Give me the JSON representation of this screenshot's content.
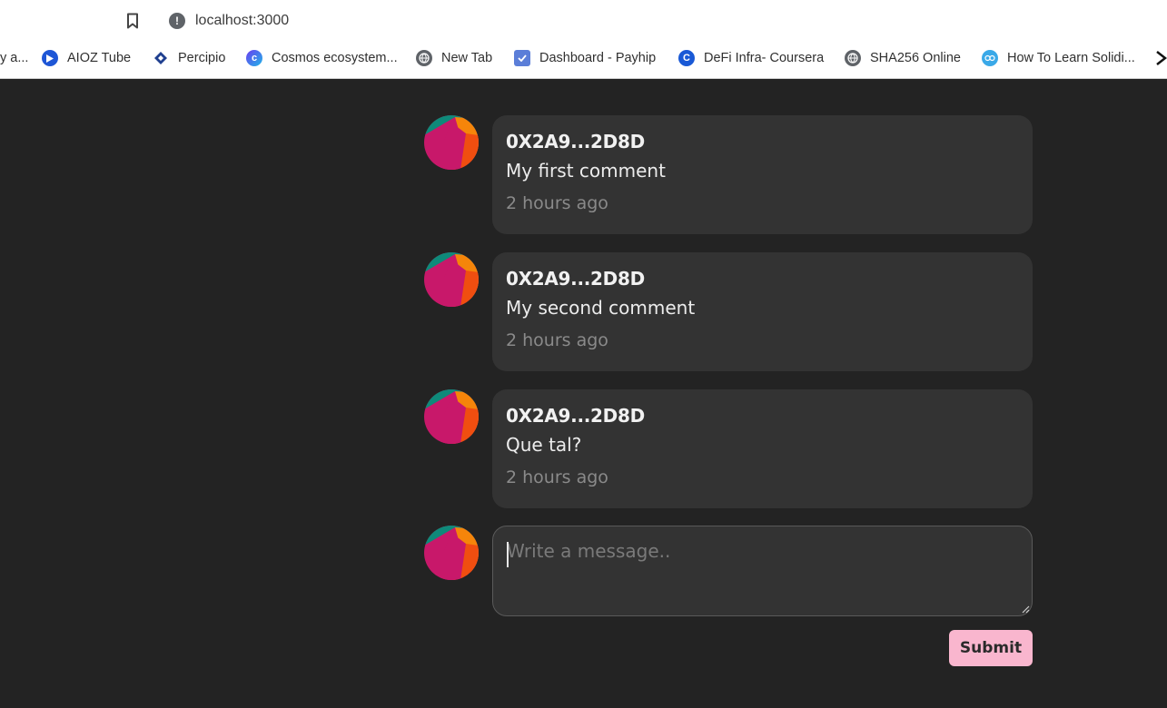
{
  "browser": {
    "url": "localhost:3000",
    "bookmarks": [
      {
        "label": "y a...",
        "icon": "cut-off-icon"
      },
      {
        "label": "AIOZ Tube",
        "icon": "aioz-play-icon"
      },
      {
        "label": "Percipio",
        "icon": "percipio-icon"
      },
      {
        "label": "Cosmos ecosystem...",
        "icon": "cosmos-icon"
      },
      {
        "label": "New Tab",
        "icon": "globe-icon"
      },
      {
        "label": "Dashboard - Payhip",
        "icon": "payhip-icon"
      },
      {
        "label": "DeFi Infra- Coursera",
        "icon": "coursera-icon"
      },
      {
        "label": "SHA256 Online",
        "icon": "globe-icon"
      },
      {
        "label": "How To Learn Solidi...",
        "icon": "solidity-icon"
      }
    ]
  },
  "comments": [
    {
      "author": "0X2A9...2D8D",
      "text": "My first comment",
      "time": "2 hours ago"
    },
    {
      "author": "0X2A9...2D8D",
      "text": "My second comment",
      "time": "2 hours ago"
    },
    {
      "author": "0X2A9...2D8D",
      "text": "Que tal?",
      "time": "2 hours ago"
    }
  ],
  "composer": {
    "placeholder": "Write a message..",
    "value": "",
    "submit_label": "Submit"
  },
  "colors": {
    "page_background": "#232323",
    "bubble_background": "#333333",
    "submit_background": "#f9b6ce",
    "avatar_colors": [
      "#c8186a",
      "#f5850a",
      "#0e8a7a",
      "#f04e10"
    ]
  }
}
